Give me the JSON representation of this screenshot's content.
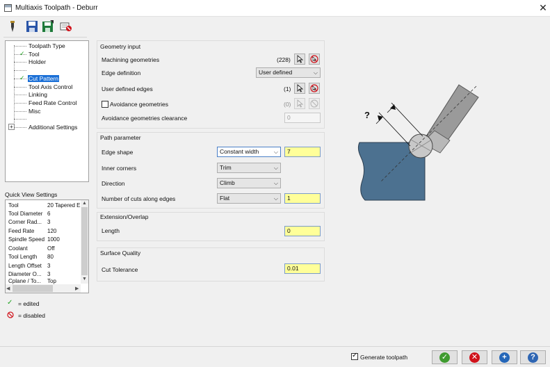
{
  "window": {
    "title": "Multiaxis Toolpath - Deburr"
  },
  "colors": {
    "accent": "#1a6fd6",
    "edited_check": "#1fa31f",
    "disabled_red": "#d0121b",
    "highlight_field": "#ffff99",
    "part_blue": "#4c7190",
    "ok_green": "#3f9b2f",
    "cancel_red": "#d0121b",
    "add_blue": "#2466b8",
    "help_blue": "#2f66b3"
  },
  "toolbar": {
    "icons": [
      "tool-icon",
      "save-icon",
      "save-as-icon",
      "clear-icon"
    ]
  },
  "tree": {
    "items": [
      {
        "label": "Toolpath Type",
        "edited": false,
        "selected": false
      },
      {
        "label": "Tool",
        "edited": true,
        "selected": false
      },
      {
        "label": "Holder",
        "edited": false,
        "selected": false
      },
      {
        "label": "",
        "edited": false,
        "selected": false
      },
      {
        "label": "Cut Pattern",
        "edited": true,
        "selected": true
      },
      {
        "label": "Tool Axis Control",
        "edited": false,
        "selected": false
      },
      {
        "label": "Linking",
        "edited": false,
        "selected": false
      },
      {
        "label": "Feed Rate Control",
        "edited": false,
        "selected": false
      },
      {
        "label": "Misc",
        "edited": false,
        "selected": false
      },
      {
        "label": "",
        "edited": false,
        "selected": false
      },
      {
        "label": "Additional Settings",
        "edited": false,
        "selected": false
      }
    ],
    "expander": "+"
  },
  "quick_view": {
    "label": "Quick View Settings",
    "rows": [
      {
        "key": "Tool",
        "value": "20 Tapered E"
      },
      {
        "key": "Tool Diameter",
        "value": "6"
      },
      {
        "key": "Corner Rad...",
        "value": "3"
      },
      {
        "key": "Feed Rate",
        "value": "120"
      },
      {
        "key": "Spindle Speed",
        "value": "1000"
      },
      {
        "key": "Coolant",
        "value": "Off"
      },
      {
        "key": "Tool Length",
        "value": "80"
      },
      {
        "key": "Length Offset",
        "value": "3"
      },
      {
        "key": "Diameter O...",
        "value": "3"
      },
      {
        "key": "Cplane / To...",
        "value": "Top"
      }
    ]
  },
  "legend": {
    "edited_label": "= edited",
    "disabled_label": "= disabled"
  },
  "geometry": {
    "title": "Geometry input",
    "machining_label": "Machining geometries",
    "machining_count": "(228)",
    "edge_def_label": "Edge definition",
    "edge_def_value": "User defined",
    "user_edges_label": "User defined edges",
    "user_edges_count": "(1)",
    "avoidance_label": "Avoidance geometries",
    "avoidance_count": "(0)",
    "avoidance_clearance_label": "Avoidance geometries clearance",
    "avoidance_clearance_value": "0"
  },
  "path": {
    "title": "Path parameter",
    "edge_shape_label": "Edge shape",
    "edge_shape_value": "Constant width",
    "edge_shape_num": "7",
    "inner_corners_label": "Inner corners",
    "inner_corners_value": "Trim",
    "direction_label": "Direction",
    "direction_value": "Climb",
    "cuts_label": "Number of cuts along edges",
    "cuts_value": "Flat",
    "cuts_num": "1"
  },
  "extension": {
    "title": "Extension/Overlap",
    "length_label": "Length",
    "length_value": "0"
  },
  "surface": {
    "title": "Surface Quality",
    "tolerance_label": "Cut Tolerance",
    "tolerance_value": "0.01"
  },
  "diagram": {
    "question_mark": "?"
  },
  "footer": {
    "generate_label": "Generate toolpath",
    "generate_checked": true
  }
}
